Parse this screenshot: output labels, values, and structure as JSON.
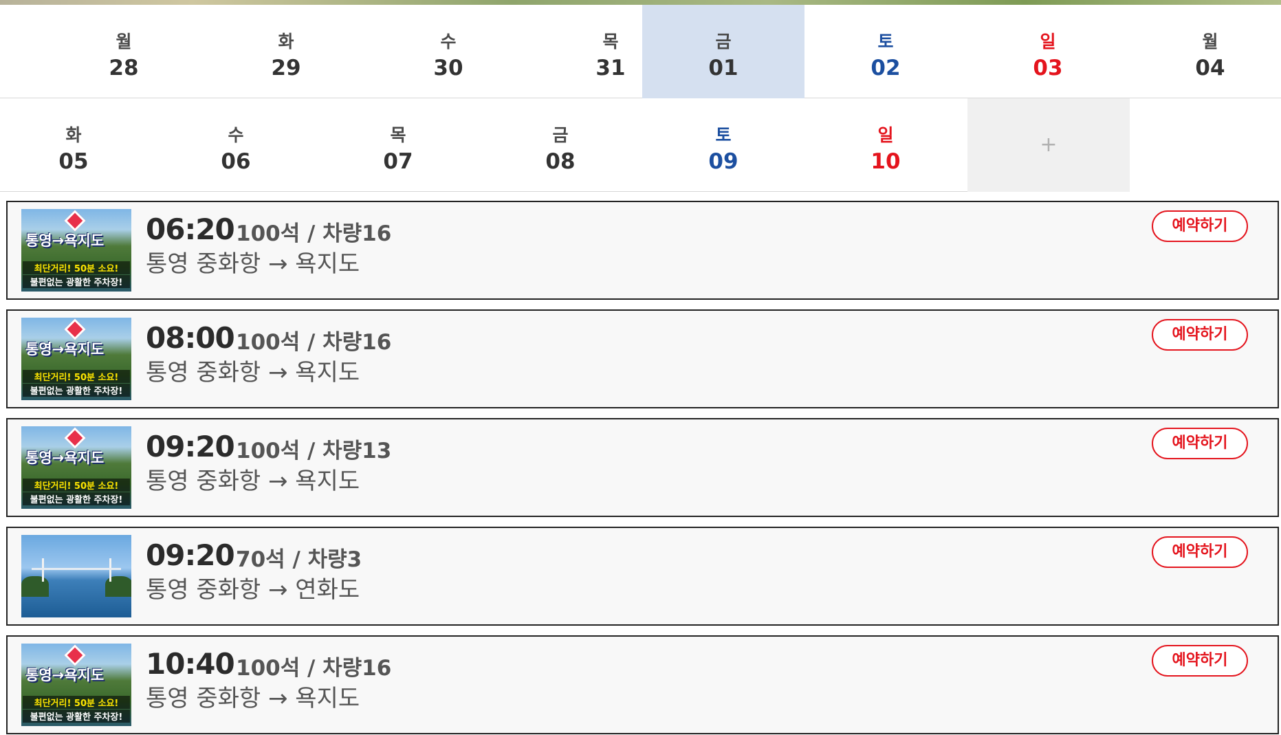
{
  "calendar": {
    "week1": [
      {
        "dow": "월",
        "day": "28"
      },
      {
        "dow": "화",
        "day": "29"
      },
      {
        "dow": "수",
        "day": "30"
      },
      {
        "dow": "목",
        "day": "31"
      },
      {
        "dow": "금",
        "day": "01"
      },
      {
        "dow": "토",
        "day": "02"
      },
      {
        "dow": "일",
        "day": "03"
      },
      {
        "dow": "월",
        "day": "04"
      }
    ],
    "week2": [
      {
        "dow": "화",
        "day": "05"
      },
      {
        "dow": "수",
        "day": "06"
      },
      {
        "dow": "목",
        "day": "07"
      },
      {
        "dow": "금",
        "day": "08"
      },
      {
        "dow": "토",
        "day": "09"
      },
      {
        "dow": "일",
        "day": "10"
      }
    ],
    "more_label": "+",
    "selected_day": "01"
  },
  "thumbnail_text": {
    "title": "통영→욕지도",
    "line1": "최단거리! 50분 소요!",
    "line2": "불편없는 광활한 주차장!"
  },
  "trips": [
    {
      "time": "06:20",
      "capacity": "100석 / 차량16",
      "route": "통영 중화항 → 욕지도",
      "thumb": "poster",
      "button": "예약하기"
    },
    {
      "time": "08:00",
      "capacity": "100석 / 차량16",
      "route": "통영 중화항 → 욕지도",
      "thumb": "poster",
      "button": "예약하기"
    },
    {
      "time": "09:20",
      "capacity": "100석 / 차량13",
      "route": "통영 중화항 → 욕지도",
      "thumb": "poster",
      "button": "예약하기"
    },
    {
      "time": "09:20",
      "capacity": "70석 / 차량3",
      "route": "통영 중화항 → 연화도",
      "thumb": "sea",
      "button": "예약하기"
    },
    {
      "time": "10:40",
      "capacity": "100석 / 차량16",
      "route": "통영 중화항 → 욕지도",
      "thumb": "poster",
      "button": "예약하기"
    }
  ],
  "colors": {
    "saturday": "#1c4fa0",
    "sunday": "#e4141d",
    "selected_bg": "#d5e0f0",
    "reserve_accent": "#e4141d"
  }
}
